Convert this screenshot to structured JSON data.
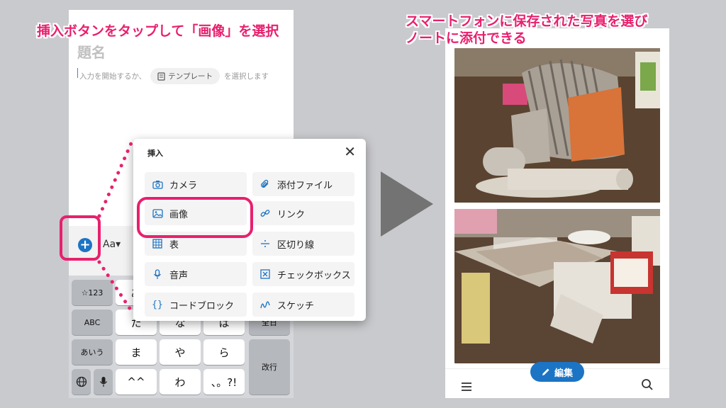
{
  "captions": {
    "left": "挿入ボタンをタップして「画像」を選択",
    "right_line1": "スマートフォンに保存された写真を選び",
    "right_line2": "ノートに添付できる"
  },
  "note": {
    "title_placeholder": "題名",
    "hint_prefix": "入力を開始するか、",
    "template_chip": "テンプレート",
    "hint_suffix": "を選択します"
  },
  "toolbar": {
    "add_label": "+",
    "format_label": "Aa▾"
  },
  "insert_menu": {
    "title": "挿入",
    "close": "✕",
    "items_left": [
      {
        "label": "カメラ",
        "icon": "camera-icon"
      },
      {
        "label": "画像",
        "icon": "image-icon"
      },
      {
        "label": "表",
        "icon": "table-icon"
      },
      {
        "label": "音声",
        "icon": "mic-icon"
      },
      {
        "label": "コードブロック",
        "icon": "code-icon"
      }
    ],
    "items_right": [
      {
        "label": "添付ファイル",
        "icon": "paperclip-icon"
      },
      {
        "label": "リンク",
        "icon": "link-icon"
      },
      {
        "label": "区切り線",
        "icon": "divider-icon"
      },
      {
        "label": "チェックボックス",
        "icon": "checkbox-icon"
      },
      {
        "label": "スケッチ",
        "icon": "sketch-icon"
      }
    ]
  },
  "keyboard": {
    "k_123": "☆123",
    "k_abc": "ABC",
    "k_aiu": "あいう",
    "row_partial": [
      "あ"
    ],
    "row2": [
      "た",
      "な",
      "は"
    ],
    "row3": [
      "ま",
      "や",
      "ら"
    ],
    "row4": [
      "^^",
      "わ",
      "、。?!"
    ],
    "space": "全日",
    "enter": "改行"
  },
  "right_phone": {
    "edit_label": "編集"
  },
  "colors": {
    "accent": "#e8206e",
    "brand": "#1c74c4"
  }
}
